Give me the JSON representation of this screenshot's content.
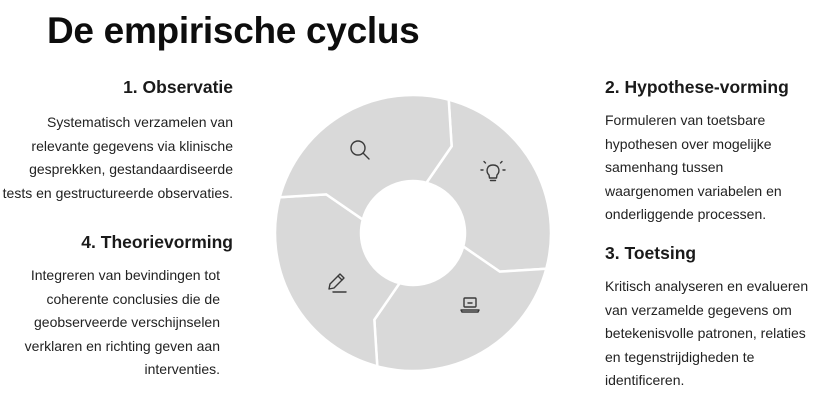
{
  "title": "De empirische cyclus",
  "steps": [
    {
      "heading": "1. Observatie",
      "text": "Systematisch verzamelen van relevante gegevens via klinische gesprekken, gestandaardiseerde tests en gestructureerde observaties.",
      "icon": "search-icon"
    },
    {
      "heading": "2. Hypothese-vorming",
      "text": "Formuleren van toetsbare hypothesen over mogelijke samenhang tussen waargenomen variabelen en onderliggende processen.",
      "icon": "lightbulb-icon"
    },
    {
      "heading": "3. Toetsing",
      "text": "Kritisch analyseren en evalueren van verzamelde gegevens om betekenisvolle patronen, relaties en tegenstrijdigheden te identificeren.",
      "icon": "laptop-icon"
    },
    {
      "heading": "4. Theorievorming",
      "text": "Integreren van bevindingen tot coherente conclusies die de geobserveerde verschijnselen verklaren en richting geven aan interventies.",
      "icon": "pencil-icon"
    }
  ],
  "colors": {
    "segment": "#d9d9d9",
    "text": "#111111"
  }
}
